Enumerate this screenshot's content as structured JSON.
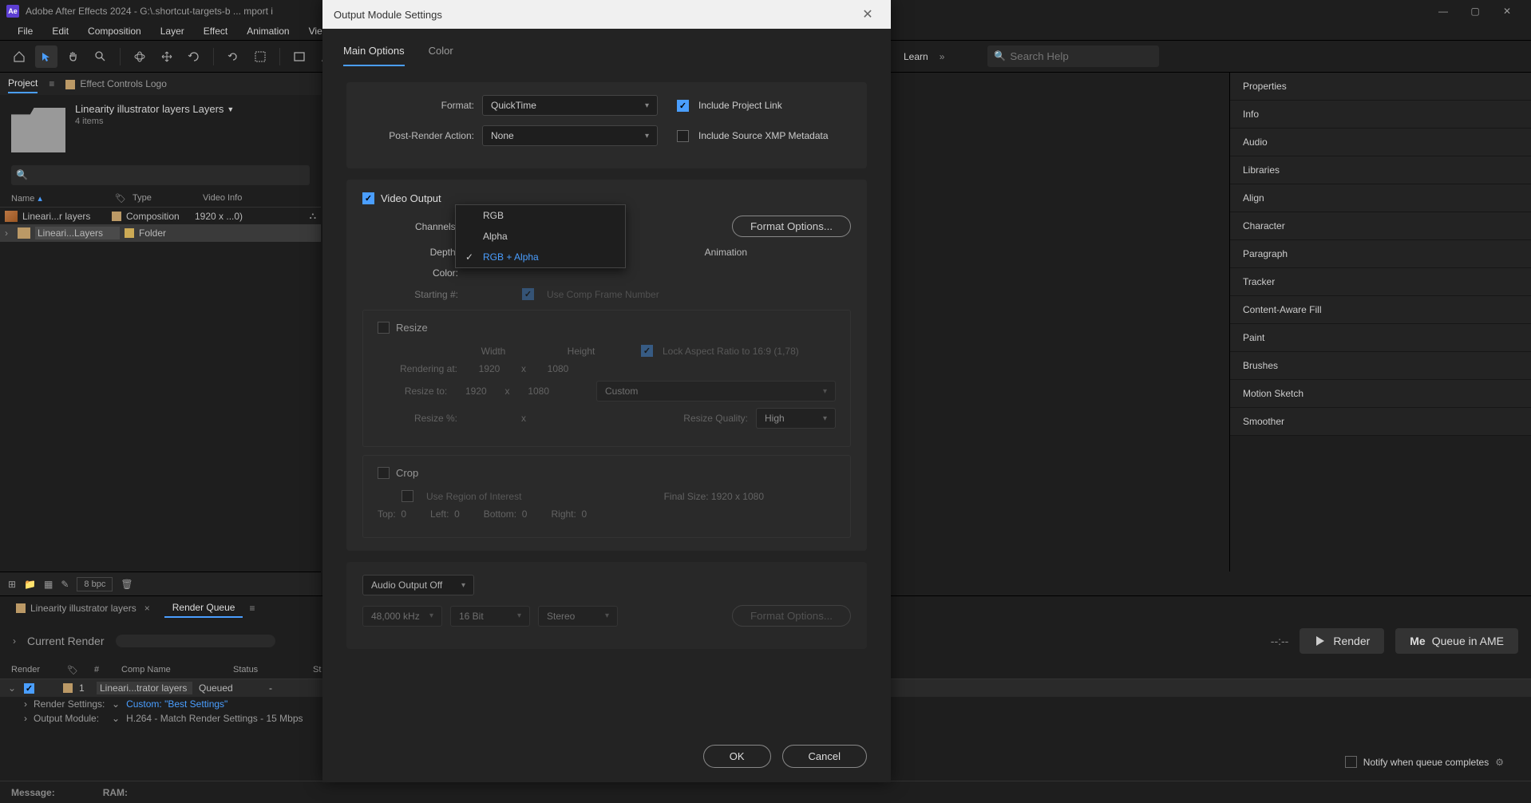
{
  "titlebar": {
    "app_icon_text": "Ae",
    "title": "Adobe After Effects 2024 - G:\\.shortcut-targets-b ... mport i"
  },
  "menubar": [
    "File",
    "Edit",
    "Composition",
    "Layer",
    "Effect",
    "Animation",
    "Vie"
  ],
  "top_right": {
    "learn": "Learn",
    "search_placeholder": "Search Help"
  },
  "project_panel": {
    "tabs": {
      "project": "Project",
      "effect_controls": "Effect Controls  Logo"
    },
    "name": "Linearity illustrator layers Layers",
    "item_count": "4 items",
    "columns": {
      "name": "Name",
      "type": "Type",
      "video_info": "Video Info"
    },
    "rows": [
      {
        "name": "Lineari...r layers",
        "type": "Composition",
        "video_info": "1920 x ...0)"
      },
      {
        "name": "Lineari...Layers",
        "type": "Folder",
        "video_info": ""
      }
    ],
    "bpc": "8 bpc"
  },
  "side_panels": [
    "Properties",
    "Info",
    "Audio",
    "Libraries",
    "Align",
    "Character",
    "Paragraph",
    "Tracker",
    "Content-Aware Fill",
    "Paint",
    "Brushes",
    "Motion Sketch",
    "Smoother"
  ],
  "timeline": {
    "tabs": {
      "comp": "Linearity illustrator layers",
      "rq": "Render Queue"
    },
    "current_render": "Current Render",
    "columns": {
      "render": "Render",
      "num": "#",
      "comp_name": "Comp Name",
      "status": "Status",
      "st": "St"
    },
    "row": {
      "num": "1",
      "comp_name": "Lineari...trator layers",
      "status": "Queued",
      "started": "-"
    },
    "render_settings_label": "Render Settings:",
    "render_settings_value": "Custom: \"Best Settings\"",
    "output_module_label": "Output Module:",
    "output_module_value": "H.264 - Match Render Settings - 15 Mbps",
    "time_display": "--:--",
    "render_btn": "Render",
    "queue_ame_btn": "Queue in AME",
    "notify_label": "Notify when queue completes"
  },
  "status": {
    "message": "Message:",
    "ram": "RAM:"
  },
  "modal": {
    "title": "Output Module Settings",
    "tabs": {
      "main": "Main Options",
      "color": "Color"
    },
    "format_label": "Format:",
    "format_value": "QuickTime",
    "post_render_label": "Post-Render Action:",
    "post_render_value": "None",
    "include_project_link": "Include Project Link",
    "include_xmp": "Include Source XMP Metadata",
    "video_output": "Video Output",
    "channels_label": "Channels:",
    "channels_value": "RGB + Alpha",
    "channels_options": [
      "RGB",
      "Alpha",
      "RGB + Alpha"
    ],
    "depth_label": "Depth:",
    "color_label": "Color:",
    "starting_label": "Starting #:",
    "use_comp_frame": "Use Comp Frame Number",
    "format_options_btn": "Format Options...",
    "animation_label": "Animation",
    "resize_label": "Resize",
    "width_label": "Width",
    "height_label": "Height",
    "lock_aspect": "Lock Aspect Ratio to 16:9 (1,78)",
    "rendering_at": "Rendering at:",
    "rendering_w": "1920",
    "rendering_h": "1080",
    "resize_to": "Resize to:",
    "resize_w": "1920",
    "resize_h": "1080",
    "resize_preset": "Custom",
    "resize_pct": "Resize %:",
    "resize_quality": "Resize Quality:",
    "resize_quality_val": "High",
    "crop_label": "Crop",
    "use_roi": "Use Region of Interest",
    "final_size": "Final Size: 1920 x 1080",
    "top": "Top:",
    "top_v": "0",
    "left": "Left:",
    "left_v": "0",
    "bottom": "Bottom:",
    "bottom_v": "0",
    "right": "Right:",
    "right_v": "0",
    "audio_output": "Audio Output Off",
    "audio_rate": "48,000 kHz",
    "audio_bit": "16 Bit",
    "audio_ch": "Stereo",
    "audio_fmt_btn": "Format Options...",
    "ok": "OK",
    "cancel": "Cancel"
  }
}
